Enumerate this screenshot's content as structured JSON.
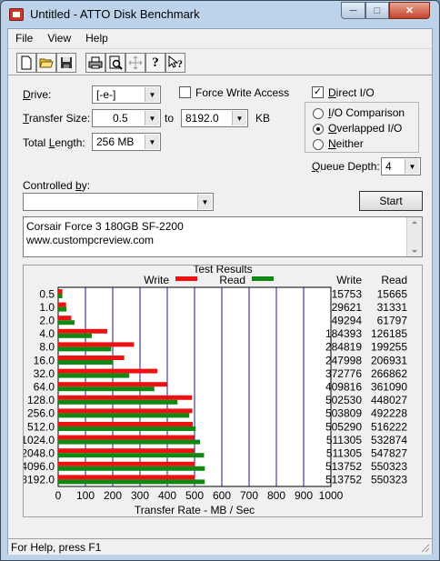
{
  "window": {
    "title": "Untitled - ATTO Disk Benchmark"
  },
  "menu": [
    "File",
    "View",
    "Help"
  ],
  "toolbar": {
    "buttons": [
      "new-icon",
      "open-icon",
      "save-icon",
      "print-icon",
      "print-preview-icon",
      "move-icon",
      "help-icon",
      "context-help-icon"
    ]
  },
  "settings": {
    "drive_label": "Drive:",
    "drive_value": "[-e-]",
    "force_write_label": "Force Write Access",
    "force_write_checked": false,
    "transfer_size_label": "Transfer Size:",
    "transfer_from": "0.5",
    "to_label": "to",
    "transfer_to": "8192.0",
    "kb_label": "KB",
    "total_length_label": "Total Length:",
    "total_length_value": "256 MB",
    "direct_io_label": "Direct I/O",
    "direct_io_checked": true,
    "io_comparison_label": "I/O Comparison",
    "overlapped_io_label": "Overlapped I/O",
    "neither_label": "Neither",
    "selected_mode": "Overlapped I/O",
    "queue_depth_label": "Queue Depth:",
    "queue_depth_value": "4",
    "controlled_by_label": "Controlled by:",
    "controlled_by_value": "",
    "start_label": "Start"
  },
  "notes": {
    "line1": "Corsair Force 3 180GB SF-2200",
    "line2": "www.custompcreview.com"
  },
  "results": {
    "title": "Test Results",
    "write_header": "Write",
    "read_header": "Read"
  },
  "chart_data": {
    "type": "bar",
    "orientation": "horizontal",
    "categories": [
      "0.5",
      "1.0",
      "2.0",
      "4.0",
      "8.0",
      "16.0",
      "32.0",
      "64.0",
      "128.0",
      "256.0",
      "512.0",
      "1024.0",
      "2048.0",
      "4096.0",
      "8192.0"
    ],
    "series": [
      {
        "name": "Write",
        "color": "#ee1111",
        "values": [
          15753,
          29621,
          49294,
          184393,
          284819,
          247998,
          372776,
          409816,
          502530,
          503809,
          505290,
          511305,
          511305,
          513752,
          513752
        ]
      },
      {
        "name": "Read",
        "color": "#118811",
        "values": [
          15665,
          31331,
          61797,
          126185,
          199255,
          206931,
          266862,
          361090,
          448027,
          492228,
          516222,
          532874,
          547827,
          550323,
          550323
        ]
      }
    ],
    "xlabel": "Transfer Rate - MB / Sec",
    "xticks": [
      "0",
      "100",
      "200",
      "300",
      "400",
      "500",
      "600",
      "700",
      "800",
      "900",
      "1000"
    ],
    "xlim": [
      0,
      1000
    ],
    "legend": "top"
  },
  "status": {
    "text": "For Help, press F1"
  }
}
